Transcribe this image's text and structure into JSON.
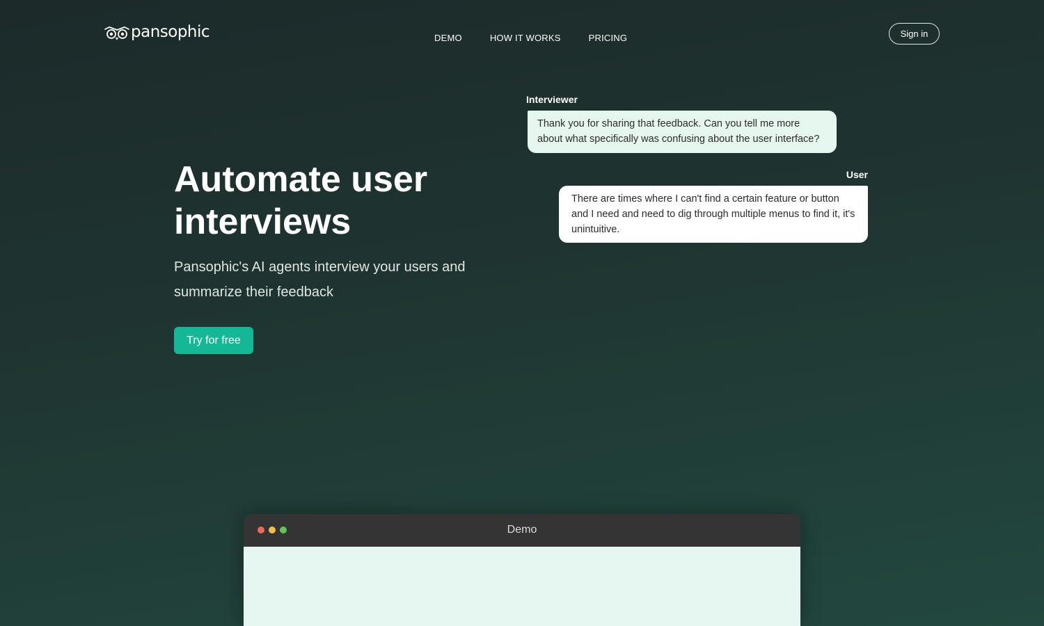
{
  "brand": {
    "name": "pansophic",
    "logo_icon": "owl-eyes-icon"
  },
  "nav": {
    "items": [
      {
        "label": "DEMO"
      },
      {
        "label": "HOW IT WORKS"
      },
      {
        "label": "PRICING"
      }
    ]
  },
  "header": {
    "sign_in_label": "Sign in"
  },
  "hero": {
    "title": "Automate user interviews",
    "subtitle": "Pansophic's AI agents interview your users and summarize their feedback",
    "cta_label": "Try for free"
  },
  "chat": {
    "interviewer": {
      "speaker": "Interviewer",
      "message": "Thank you for sharing that feedback. Can you tell me more about what specifically was confusing about the user interface?"
    },
    "user": {
      "speaker": "User",
      "message": "There are times where I can't find a certain feature or button and I need and need to dig through multiple menus to find it, it's unintuitive."
    }
  },
  "demo": {
    "window_title": "Demo"
  },
  "colors": {
    "accent": "#14b897",
    "interviewer_bubble": "#e6f7f0",
    "user_bubble": "#ffffff",
    "demo_titlebar": "#343434",
    "demo_body": "#e6f6f0",
    "window_dot_red": "#ee6a5f",
    "window_dot_yellow": "#f5bd4f",
    "window_dot_green": "#61c454"
  }
}
